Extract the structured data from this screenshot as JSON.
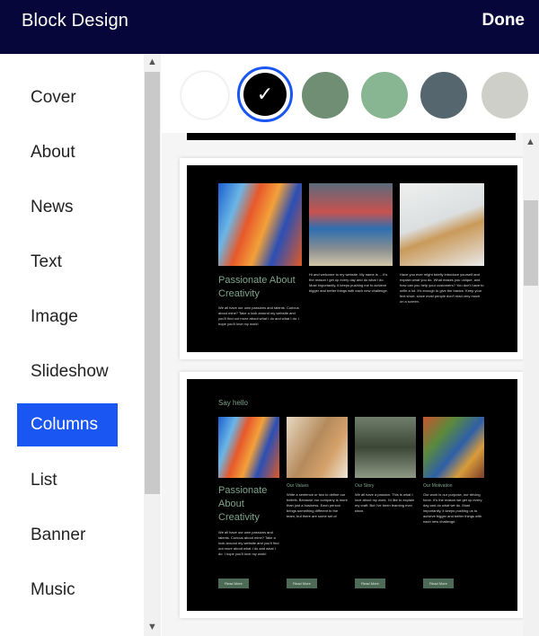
{
  "header": {
    "title": "Block Design",
    "done_label": "Done"
  },
  "sidebar": {
    "items": [
      {
        "label": "Cover"
      },
      {
        "label": "About"
      },
      {
        "label": "News"
      },
      {
        "label": "Text"
      },
      {
        "label": "Image"
      },
      {
        "label": "Slideshow"
      },
      {
        "label": "Columns",
        "active": true
      },
      {
        "label": "List"
      },
      {
        "label": "Banner"
      },
      {
        "label": "Music"
      }
    ]
  },
  "colors": {
    "accent": "#1a56f2",
    "header_bg": "#06063a",
    "swatches": [
      "#ffffff",
      "#000000",
      "#6f8e73",
      "#88b592",
      "#56666f",
      "#cfcfca"
    ],
    "selected_swatch": "#000000"
  },
  "preview": {
    "card1": {
      "heading": "Passionate About Creativity",
      "col1_text": "We all have our own passions and talents. Curious about mine? Take a look around my website and you'll find out more about what I do and what I do. I hope you'll love my work!",
      "col2_text": "Hi and welcome to my website. My name is ... It's the reason I get up every day and do what I do. Most importantly, it keeps pushing me to achieve bigger and better things with each new challenge.",
      "col3_text": "Have you ever might briefly introduce yourself and explain what you do. What makes you unique, and how can you help your customers? You don't have to write a lot. It's enough to give the basics. Keep your text short, since most people don't read very much on a screen."
    },
    "card2": {
      "say_hello": "Say hello",
      "heading": "Passionate About Creativity",
      "intro_text": "We all have our own passions and talents. Curious about mine? Take a look around my website and you'll find out more about what I do and what I do. I hope you'll love my work!",
      "columns": [
        {
          "title": "Our Values",
          "text": "Write a sentence or two to define our beliefs. Because our company is more than just a business. Each person brings something different to the team, but there are some set of values we all share."
        },
        {
          "title": "Our Story",
          "text": "We all have a passion. This is what I love about my work. I'd like to explain my craft. But I've been learning ever since."
        },
        {
          "title": "Our Motivation",
          "text": "Our work is our purpose, our driving force. It's the reason we get up every day and do what we do. Most importantly, it keeps pushing us to achieve bigger and better things with each new challenge."
        }
      ],
      "button_label": "Read More"
    }
  }
}
